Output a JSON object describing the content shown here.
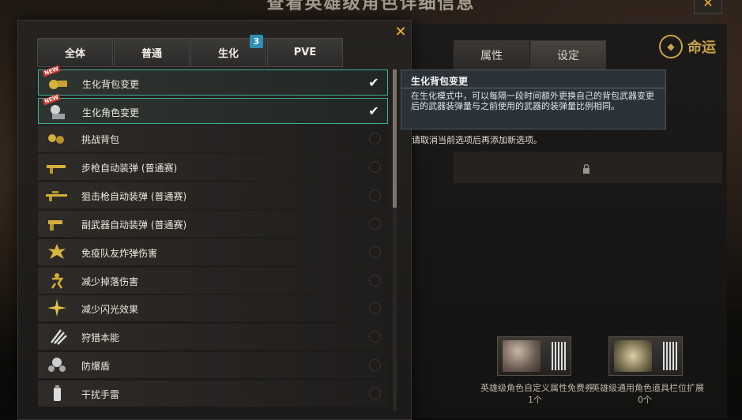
{
  "window": {
    "title": "查看英雄级角色详细信息"
  },
  "brand": {
    "name": "命运"
  },
  "tabs": [
    {
      "label": "全体"
    },
    {
      "label": "普通"
    },
    {
      "label": "生化",
      "badge": "3"
    },
    {
      "label": "PVE"
    }
  ],
  "items": [
    {
      "label": "生化背包变更",
      "icon": "gold-backpack-icon",
      "new": true,
      "selected": true
    },
    {
      "label": "生化角色变更",
      "icon": "character-swap-icon",
      "new": true,
      "selected": true
    },
    {
      "label": "挑战背包",
      "icon": "challenge-backpack-icon",
      "new": false,
      "selected": false
    },
    {
      "label": "步枪自动装弹 (普通赛)",
      "icon": "rifle-icon",
      "new": false,
      "selected": false
    },
    {
      "label": "狙击枪自动装弹 (普通赛)",
      "icon": "sniper-icon",
      "new": false,
      "selected": false
    },
    {
      "label": "副武器自动装弹 (普通赛)",
      "icon": "pistol-icon",
      "new": false,
      "selected": false
    },
    {
      "label": "免疫队友炸弹伤害",
      "icon": "explosion-icon",
      "new": false,
      "selected": false
    },
    {
      "label": "减少掉落伤害",
      "icon": "fall-icon",
      "new": false,
      "selected": false
    },
    {
      "label": "减少闪光效果",
      "icon": "flash-icon",
      "new": false,
      "selected": false
    },
    {
      "label": "狩猎本能",
      "icon": "claw-icon",
      "new": false,
      "selected": false
    },
    {
      "label": "防爆盾",
      "icon": "shield-blast-icon",
      "new": false,
      "selected": false
    },
    {
      "label": "干扰手雷",
      "icon": "grenade-icon",
      "new": false,
      "selected": false
    }
  ],
  "new_badge": "NEW",
  "tooltip": {
    "title": "生化背包变更",
    "description": "在生化模式中，可以每隔一段时间额外更换自己的背包武器变更后的武器装弹量与之前使用的武器的装弹量比例相同。"
  },
  "hint": "请取消当前选项后再添加新选项。",
  "right_tabs": [
    {
      "label": "属性"
    },
    {
      "label": "设定"
    }
  ],
  "rewards": [
    {
      "name": "英雄级角色自定义属性免费券",
      "count": "1个"
    },
    {
      "name": "英雄级通用角色道具栏位扩展",
      "count": "0个"
    }
  ],
  "colors": {
    "accent_close": "#f2b32a",
    "selection_border": "#3cb09c",
    "badge": "#2f8fb4",
    "tooltip_bg": "#2c343a"
  }
}
